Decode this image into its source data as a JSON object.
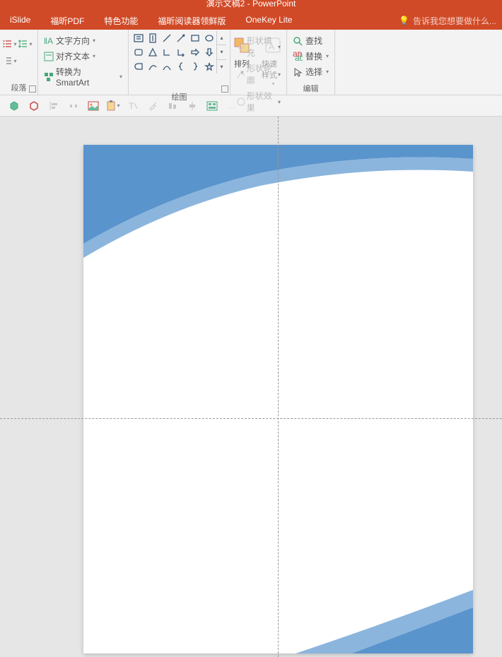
{
  "title": "演示文稿2 - PowerPoint",
  "tabs": {
    "islide": "iSlide",
    "foxit_pdf": "福昕PDF",
    "special": "特色功能",
    "foxit_reader": "福昕阅读器领鲜版",
    "onekey": "OneKey Lite"
  },
  "tell_me": "告诉我您想要做什么...",
  "ribbon": {
    "paragraph": {
      "label": "段落"
    },
    "text_direction": {
      "direction": "文字方向",
      "align": "对齐文本",
      "smartart": "转换为 SmartArt"
    },
    "drawing": {
      "label": "绘图",
      "arrange": "排列",
      "quick_styles": "快速样式"
    },
    "shape_style": {
      "fill": "形状填充",
      "outline": "形状轮廓",
      "effects": "形状效果"
    },
    "editing": {
      "label": "编辑",
      "find": "查找",
      "replace": "替换",
      "select": "选择"
    }
  }
}
